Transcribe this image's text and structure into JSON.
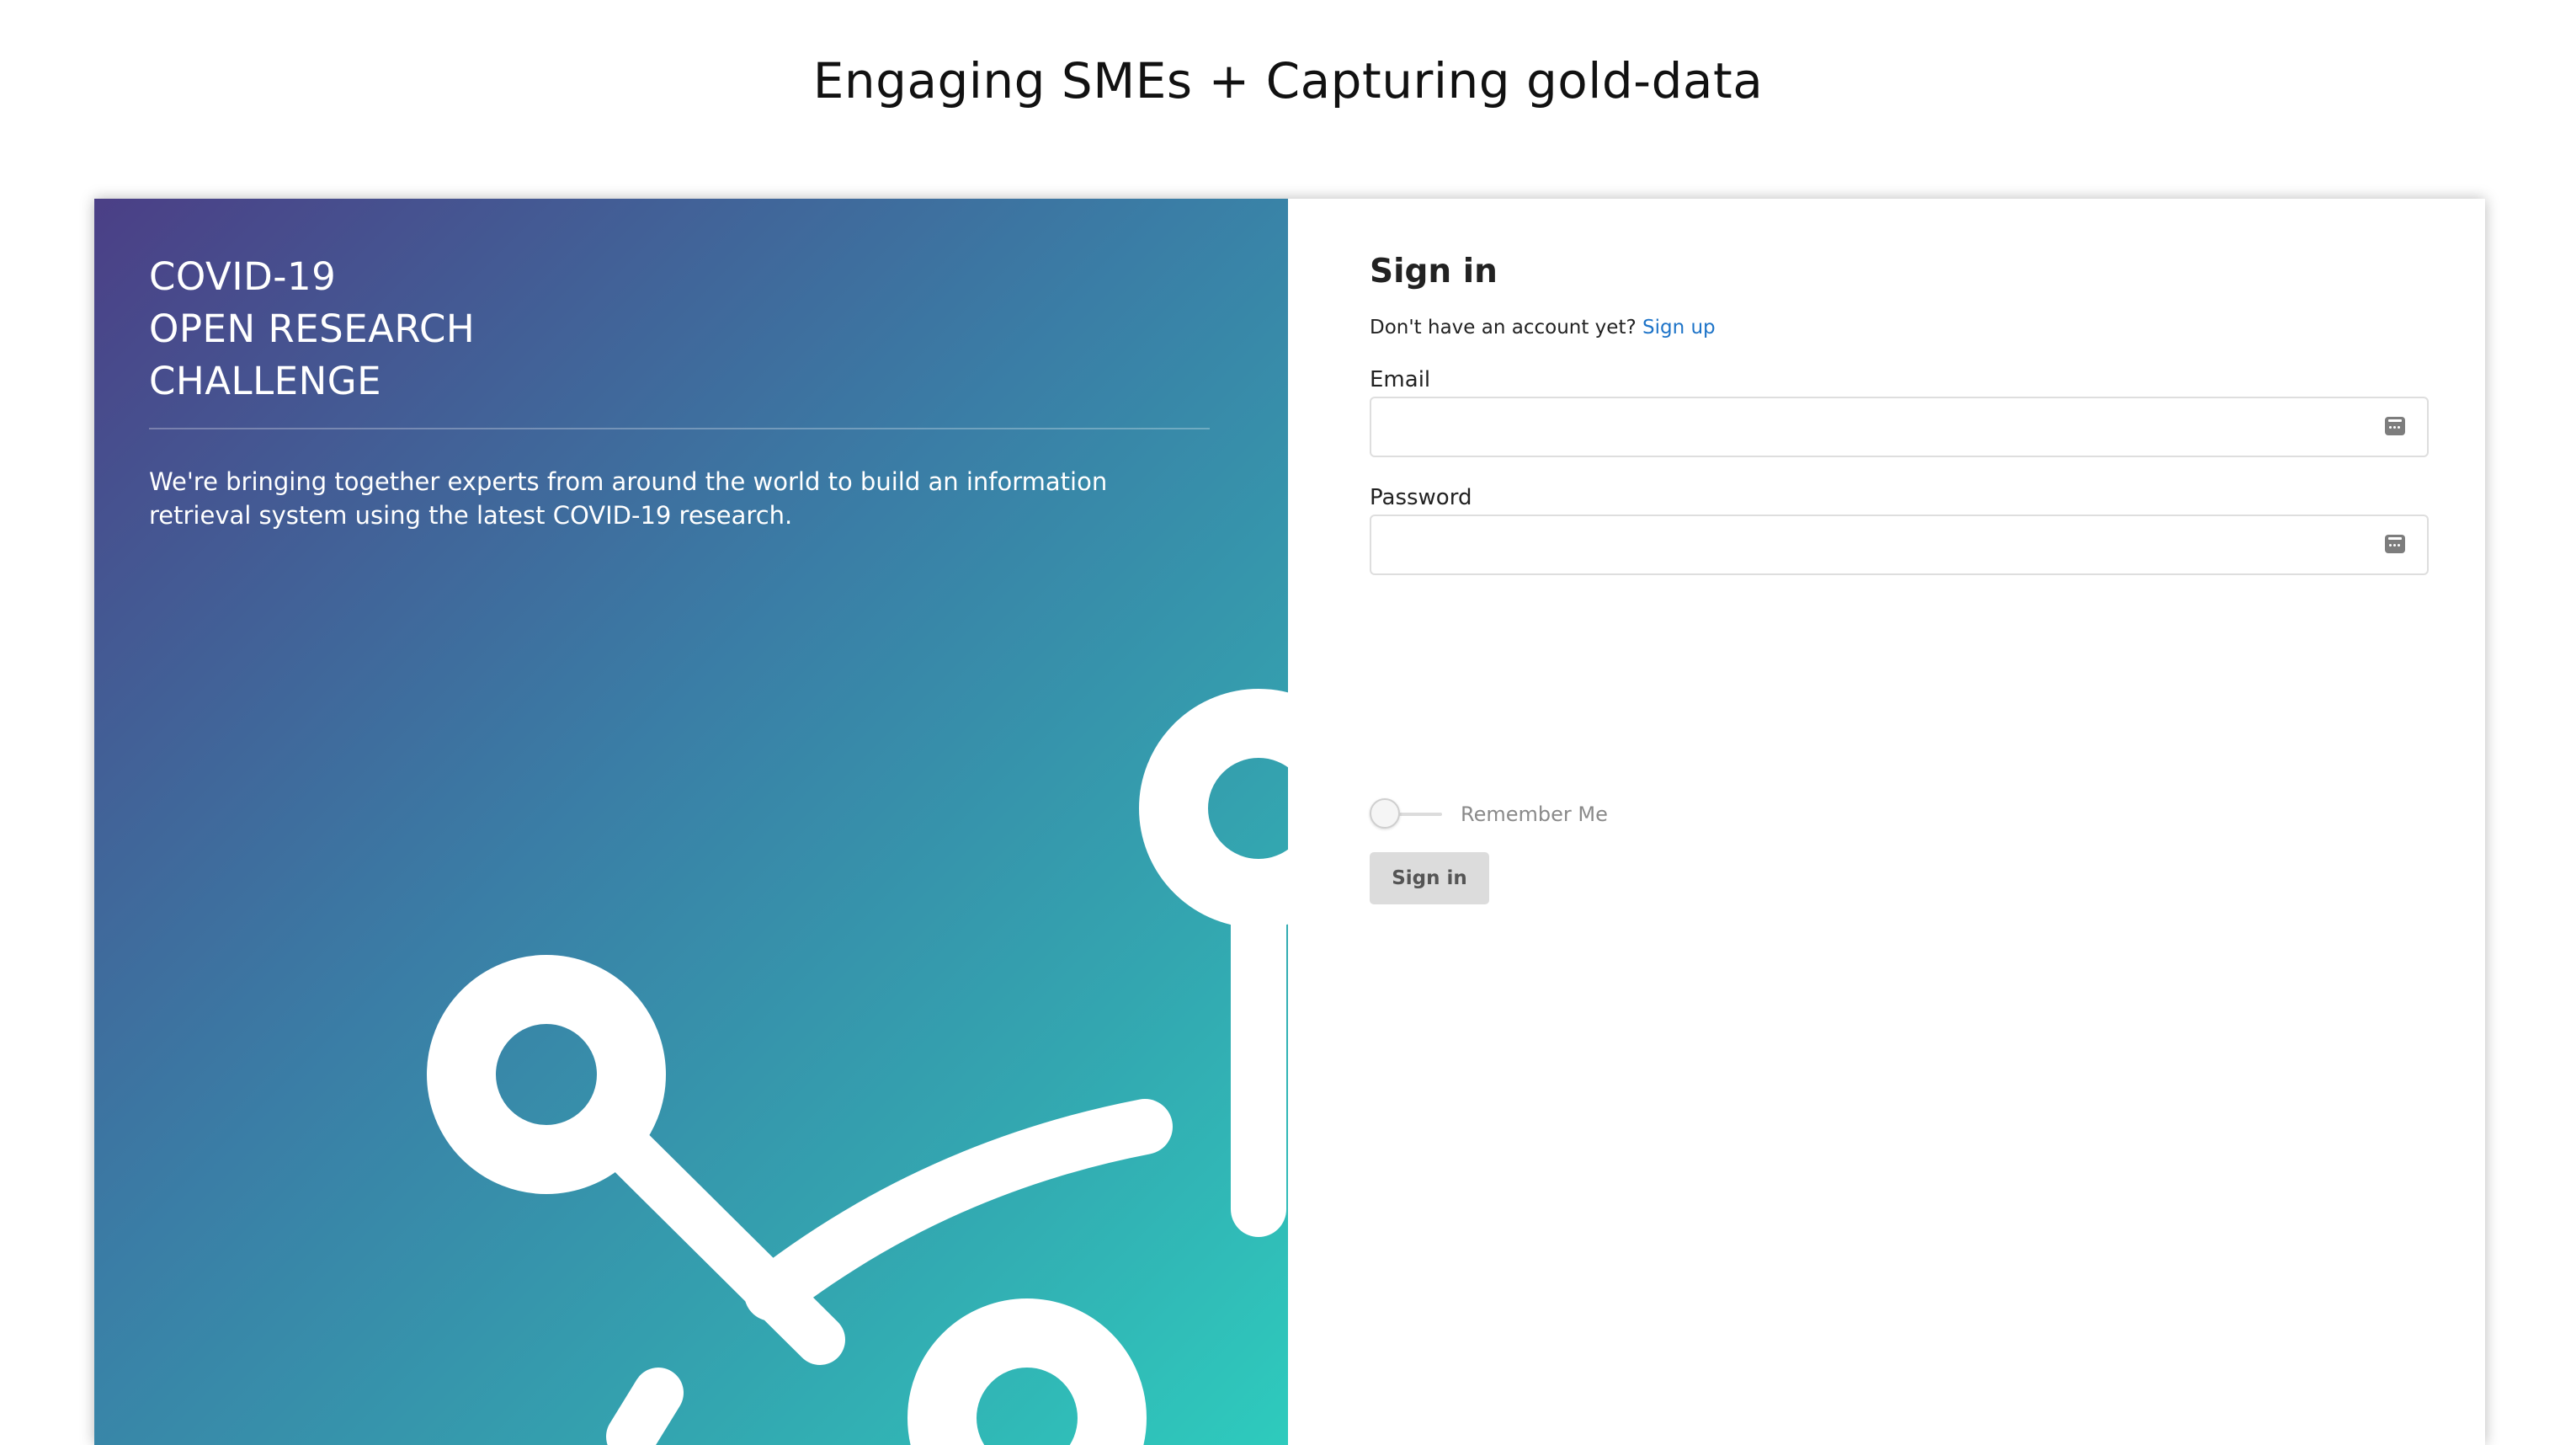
{
  "slide": {
    "title": "Engaging SMEs + Capturing gold-data"
  },
  "left_panel": {
    "title_lines": [
      "COVID-19",
      "OPEN RESEARCH",
      "CHALLENGE"
    ],
    "description": "We're bringing together experts from around the world to build an information retrieval system using the latest COVID-19 research.",
    "gradient_colors": [
      "#4b3f86",
      "#3a7ea6",
      "#33a6b0",
      "#2ecbbd"
    ]
  },
  "signin": {
    "heading": "Sign in",
    "no_account_text": "Don't have an account yet?",
    "signup_link": "Sign up",
    "email_label": "Email",
    "email_value": "",
    "password_label": "Password",
    "password_value": "",
    "remember_label": "Remember Me",
    "remember_checked": false,
    "submit_label": "Sign in",
    "field_icon": "password-manager-key-icon",
    "link_color": "#1e74c8"
  }
}
